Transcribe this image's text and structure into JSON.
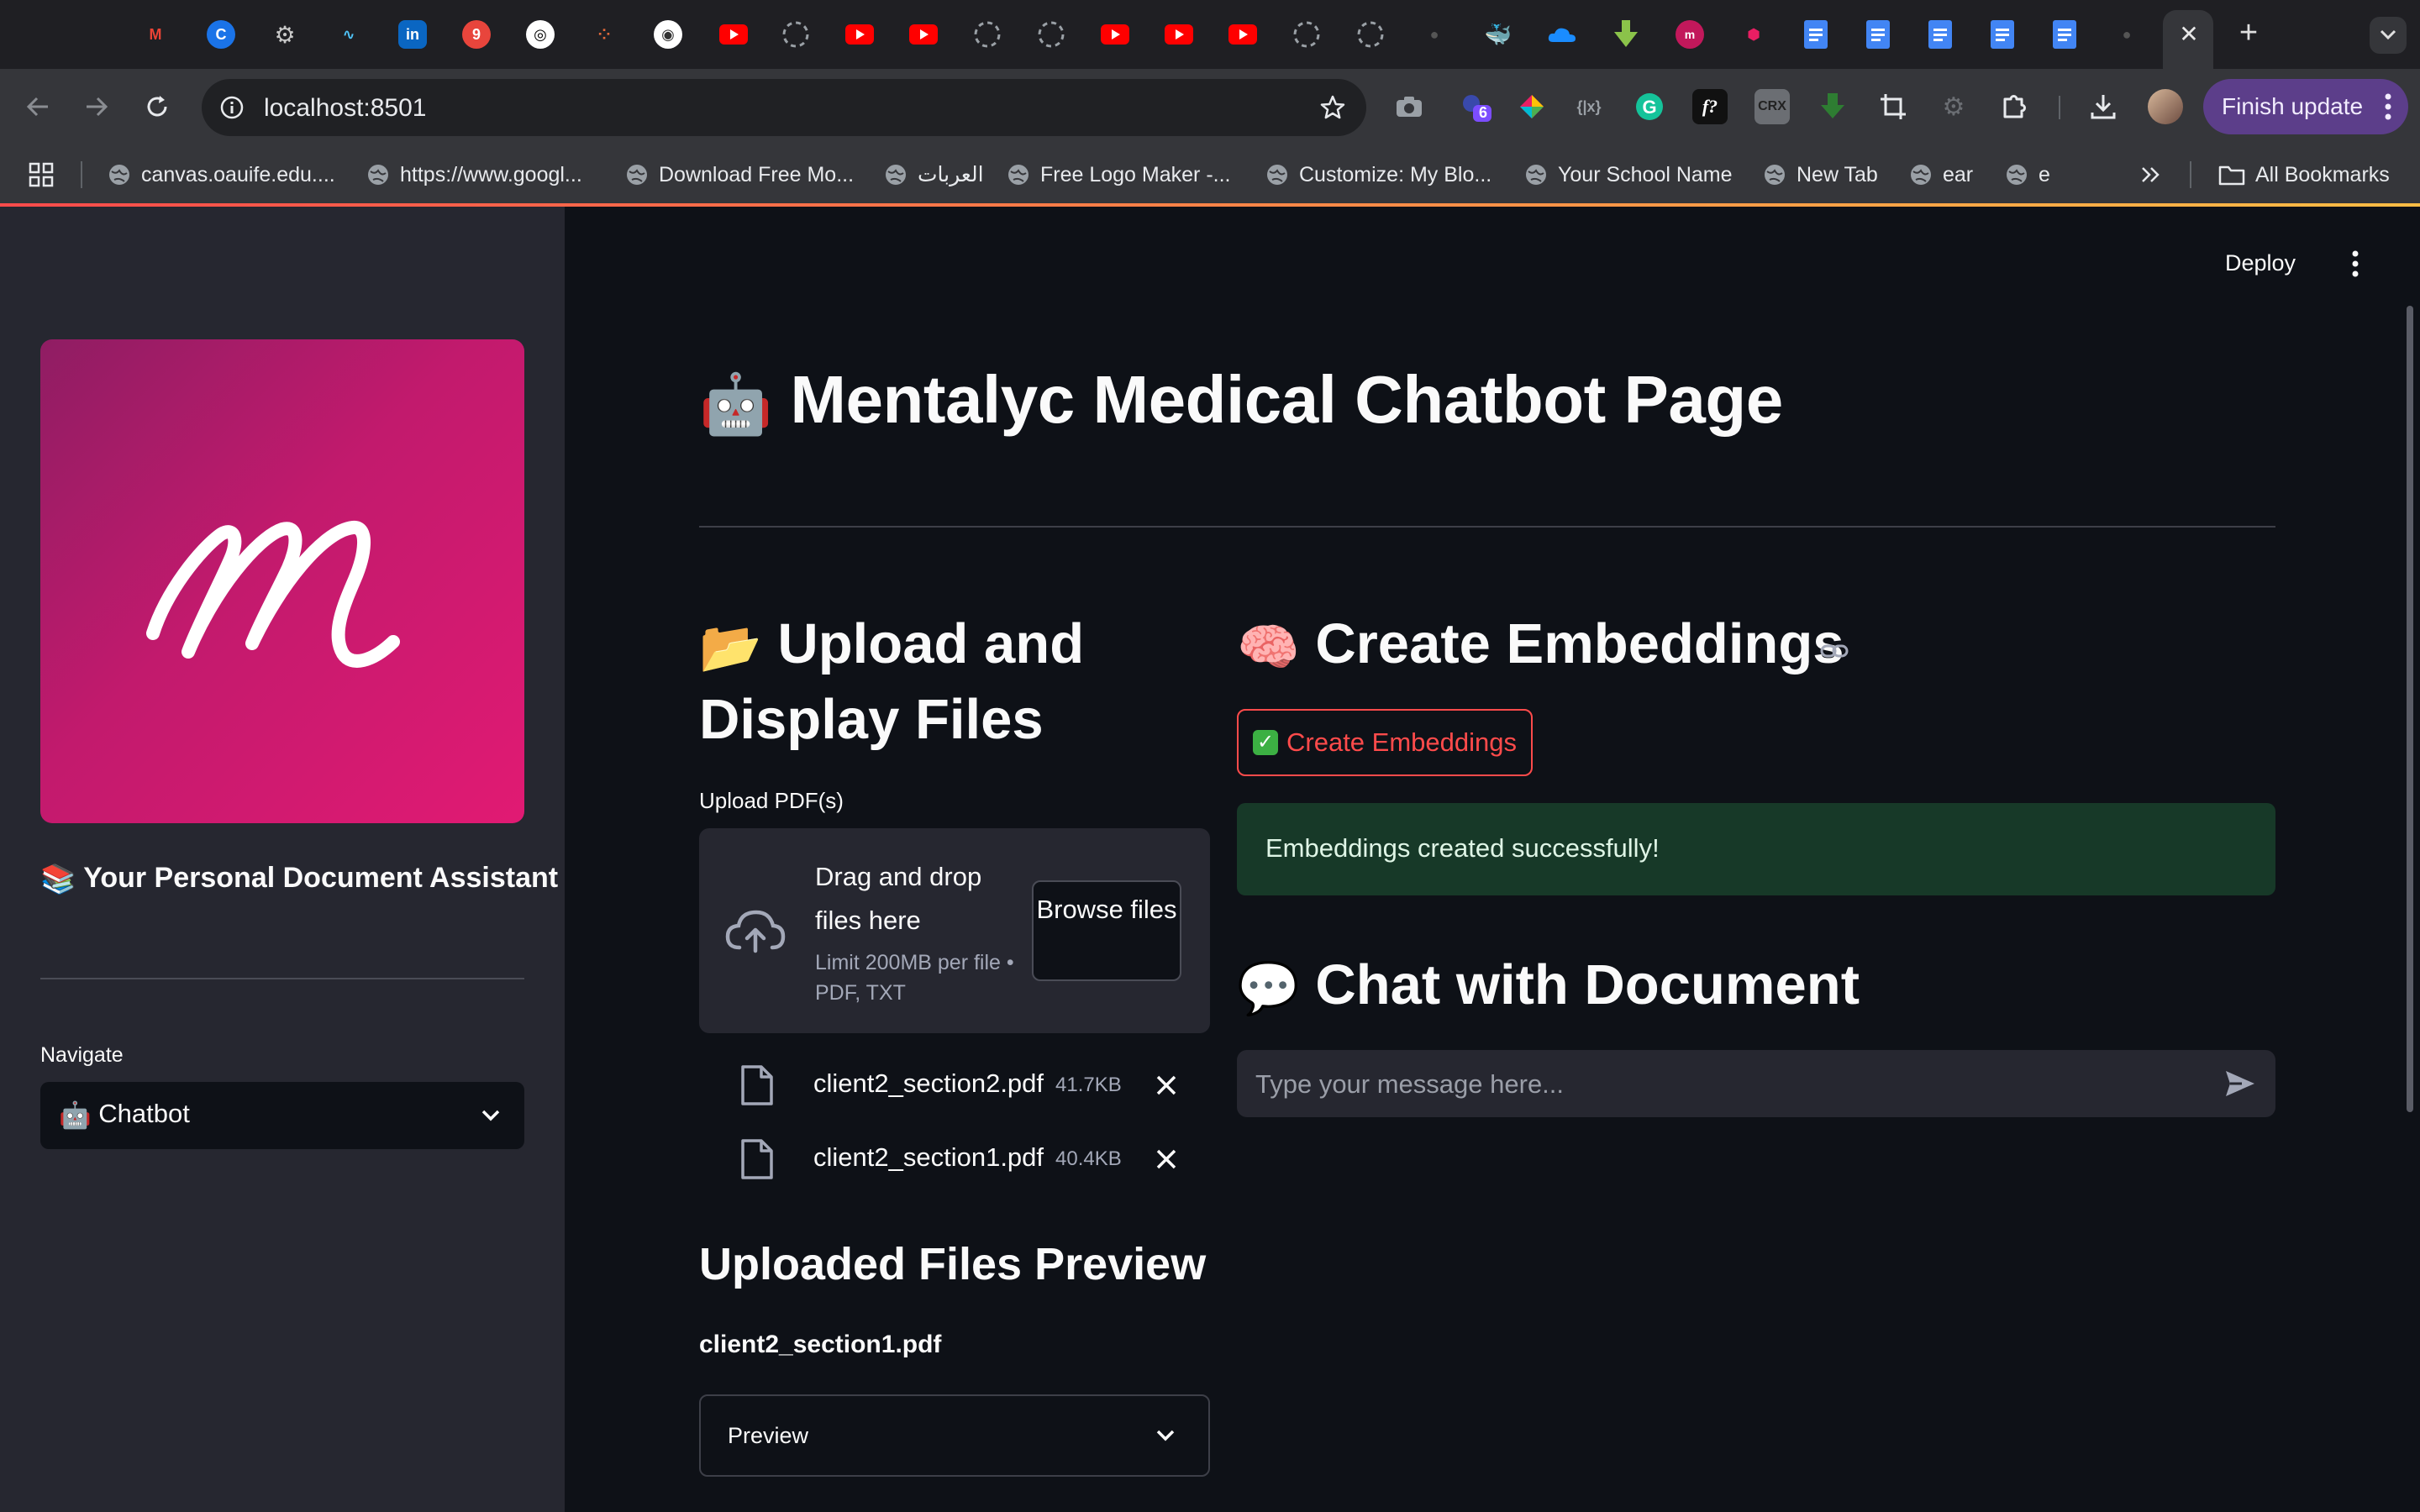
{
  "browser": {
    "url": "localhost:8501",
    "finish_update_label": "Finish update",
    "extension_badge": "6",
    "extension_text_fx": "f?",
    "extension_text_crx": "CRX",
    "extension_text_code": "{|x}",
    "tab_badge": "9",
    "bookmarks": [
      "canvas.oauife.edu....",
      "https://www.googl...",
      "Download Free Mo...",
      "العربات",
      "Free Logo Maker -...",
      "Customize: My Blo...",
      "Your School Name",
      "New Tab",
      "ear",
      "e"
    ],
    "all_bookmarks_label": "All Bookmarks"
  },
  "toolbar": {
    "deploy_label": "Deploy"
  },
  "sidebar": {
    "logo_letter": "m",
    "tagline": "Your Personal Document Assistant",
    "tagline_emoji": "📚",
    "navigate_label": "Navigate",
    "nav_selected": "Chatbot",
    "nav_selected_emoji": "🤖"
  },
  "main": {
    "title_emoji": "🤖",
    "title": "Mentalyc Medical Chatbot Page",
    "upload": {
      "heading_emoji": "📂",
      "heading": "Upload and Display Files",
      "label": "Upload PDF(s)",
      "drop_title": "Drag and drop files here",
      "drop_limit": "Limit 200MB per file • PDF, TXT",
      "browse_label": "Browse files",
      "files": [
        {
          "name": "client2_section2.pdf",
          "size": "41.7KB"
        },
        {
          "name": "client2_section1.pdf",
          "size": "40.4KB"
        }
      ]
    },
    "preview": {
      "heading": "Uploaded Files Preview",
      "file_name": "client2_section1.pdf",
      "expander_label": "Preview"
    },
    "embeddings": {
      "heading_emoji": "🧠",
      "heading": "Create Embeddings",
      "button_label": "Create Embeddings",
      "button_check": "✓",
      "success_message": "Embeddings created successfully!"
    },
    "chat": {
      "heading_emoji": "💬",
      "heading": "Chat with Document",
      "placeholder": "Type your message here..."
    }
  },
  "colors": {
    "primary": "#ff4b4b",
    "background": "#0e1117",
    "sidebar_bg": "#262730",
    "success_bg": "#173928",
    "update_button": "#5c3e8a"
  }
}
